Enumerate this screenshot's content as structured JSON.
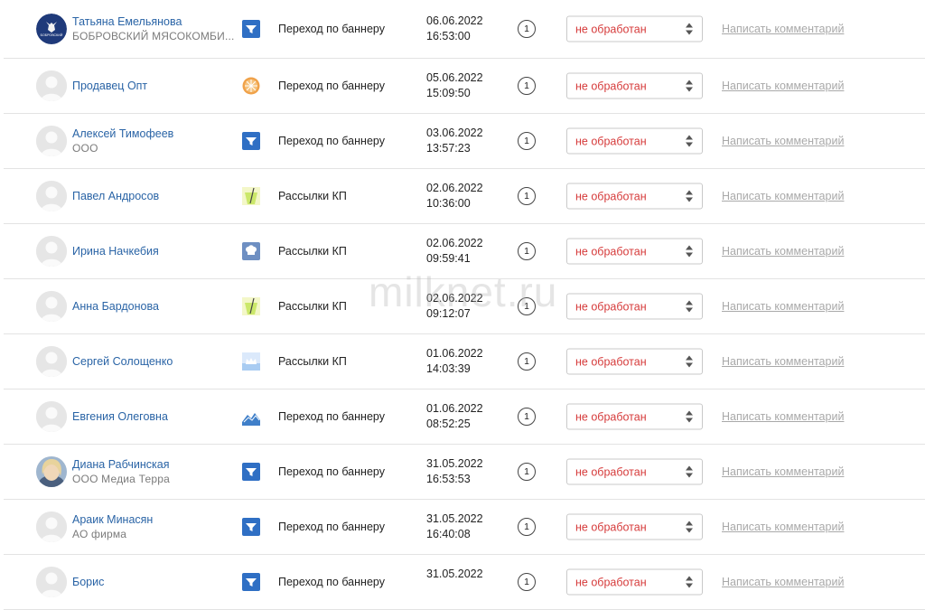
{
  "watermark": "milknet.ru",
  "status_color": "#d63b3b",
  "link_color": "#2a64a6",
  "rows": [
    {
      "name": "Татьяна Емельянова",
      "company": "БОБРОВСКИЙ МЯСОКОМБИ...",
      "source_icon": "funnel-icon",
      "source": "Переход по баннеру",
      "date": "06.06.2022",
      "time": "16:53:00",
      "count": "1",
      "status": "не обработан",
      "comment": "Написать комментарий"
    },
    {
      "name": "Продавец Опт",
      "company": "",
      "source_icon": "orange-slice-icon",
      "source": "Переход по баннеру",
      "date": "05.06.2022",
      "time": "15:09:50",
      "count": "1",
      "status": "не обработан",
      "comment": "Написать комментарий"
    },
    {
      "name": "Алексей Тимофеев",
      "company": "ООО",
      "source_icon": "funnel-icon",
      "source": "Переход по баннеру",
      "date": "03.06.2022",
      "time": "13:57:23",
      "count": "1",
      "status": "не обработан",
      "comment": "Написать комментарий"
    },
    {
      "name": "Павел Андросов",
      "company": "",
      "source_icon": "drink-icon",
      "source": "Рассылки КП",
      "date": "02.06.2022",
      "time": "10:36:00",
      "count": "1",
      "status": "не обработан",
      "comment": "Написать комментарий"
    },
    {
      "name": "Ирина Начкебия",
      "company": "",
      "source_icon": "chef-hat-icon",
      "source": "Рассылки КП",
      "date": "02.06.2022",
      "time": "09:59:41",
      "count": "1",
      "status": "не обработан",
      "comment": "Написать комментарий"
    },
    {
      "name": "Анна Бардонова",
      "company": "",
      "source_icon": "drink-icon",
      "source": "Рассылки КП",
      "date": "02.06.2022",
      "time": "09:12:07",
      "count": "1",
      "status": "не обработан",
      "comment": "Написать комментарий"
    },
    {
      "name": "Сергей Солощенко",
      "company": "",
      "source_icon": "crown-icon",
      "source": "Рассылки КП",
      "date": "01.06.2022",
      "time": "14:03:39",
      "count": "1",
      "status": "не обработан",
      "comment": "Написать комментарий"
    },
    {
      "name": "Евгения Олеговна",
      "company": "",
      "source_icon": "mountains-icon",
      "source": "Переход по баннеру",
      "date": "01.06.2022",
      "time": "08:52:25",
      "count": "1",
      "status": "не обработан",
      "comment": "Написать комментарий"
    },
    {
      "name": "Диана Рабчинская",
      "company": "ООО Медиа Терра",
      "source_icon": "funnel-icon",
      "source": "Переход по баннеру",
      "date": "31.05.2022",
      "time": "16:53:53",
      "count": "1",
      "status": "не обработан",
      "comment": "Написать комментарий"
    },
    {
      "name": "Араик Минасян",
      "company": "АО фирма",
      "source_icon": "funnel-icon",
      "source": "Переход по баннеру",
      "date": "31.05.2022",
      "time": "16:40:08",
      "count": "1",
      "status": "не обработан",
      "comment": "Написать комментарий"
    },
    {
      "name": "Борис",
      "company": "",
      "source_icon": "funnel-icon",
      "source": "Переход по баннеру",
      "date": "31.05.2022",
      "time": "",
      "count": "1",
      "status": "не обработан",
      "comment": "Написать комментарий"
    }
  ],
  "avatars": [
    "logo-avatar",
    "default-avatar",
    "default-avatar",
    "default-avatar",
    "default-avatar",
    "default-avatar",
    "default-avatar",
    "default-avatar",
    "photo-avatar",
    "default-avatar",
    "default-avatar"
  ],
  "logo_avatar_text": "БОБРОВСКИЙ"
}
